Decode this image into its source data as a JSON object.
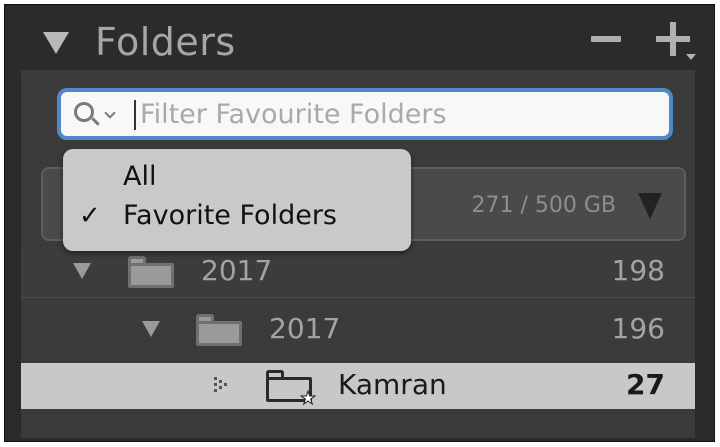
{
  "panel": {
    "title": "Folders",
    "collapse_icon": "triangle-down-icon",
    "remove_icon": "minus-icon",
    "add_icon": "plus-dropdown-icon"
  },
  "search": {
    "placeholder": "Filter Favourite Folders",
    "icon": "search-dropdown-icon"
  },
  "filter_menu": {
    "items": [
      {
        "label": "All",
        "checked": false
      },
      {
        "label": "Favorite Folders",
        "checked": true
      }
    ],
    "check_mark": "✓"
  },
  "volume": {
    "size": "271 / 500 GB",
    "toggle_icon": "triangle-down-icon"
  },
  "folders": [
    {
      "name": "2017",
      "count": "198",
      "expanded": true,
      "selected": false
    },
    {
      "name": "2017",
      "count": "196",
      "expanded": true,
      "selected": false
    },
    {
      "name": "Kamran",
      "count": "27",
      "expanded": false,
      "selected": true,
      "favorite": true
    }
  ],
  "colors": {
    "panel_bg": "#2a2a2a",
    "body_bg": "#3b3b3b",
    "selected_row": "#c8c8c8",
    "search_focus": "#4f89c7",
    "menu_bg": "#c9c9c9"
  }
}
